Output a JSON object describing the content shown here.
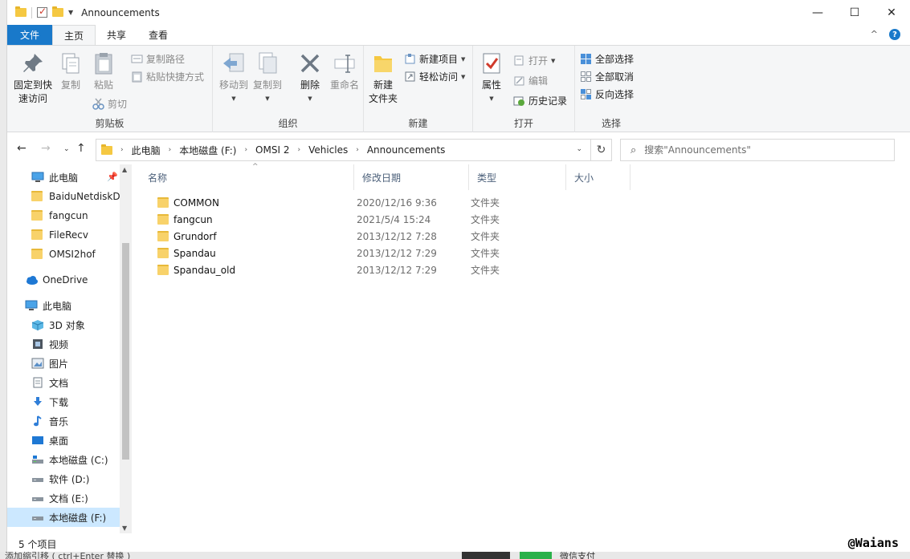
{
  "window": {
    "title": "Announcements",
    "controls": {
      "minimize": "—",
      "maximize": "☐",
      "close": "✕"
    }
  },
  "ribbon_tabs": [
    "文件",
    "主页",
    "共享",
    "查看"
  ],
  "ribbon_right": {
    "collapse": "^",
    "help": "?"
  },
  "ribbon": {
    "clipboard": {
      "label": "剪贴板",
      "pin": "固定到快速访问",
      "pin_line1": "固定到快",
      "pin_line2": "速访问",
      "copy": "复制",
      "paste": "粘贴",
      "copy_path": "复制路径",
      "paste_shortcut": "粘贴快捷方式",
      "cut": "剪切"
    },
    "organize": {
      "label": "组织",
      "move_to": "移动到",
      "copy_to": "复制到",
      "delete": "删除",
      "rename": "重命名"
    },
    "new": {
      "label": "新建",
      "new_folder_line1": "新建",
      "new_folder_line2": "文件夹",
      "new_item": "新建项目",
      "easy_access": "轻松访问"
    },
    "open": {
      "label": "打开",
      "properties": "属性",
      "open": "打开",
      "edit": "编辑",
      "history": "历史记录"
    },
    "select": {
      "label": "选择",
      "select_all": "全部选择",
      "select_none": "全部取消",
      "invert": "反向选择"
    }
  },
  "address": {
    "crumbs": [
      "此电脑",
      "本地磁盘 (F:)",
      "OMSI 2",
      "Vehicles",
      "Announcements"
    ]
  },
  "search": {
    "placeholder": "搜索\"Announcements\""
  },
  "nav_pane": {
    "quick_access": [
      {
        "label": "此电脑",
        "icon": "pc-icon"
      },
      {
        "label": "BaiduNetdiskD",
        "icon": "folder-icon"
      },
      {
        "label": "fangcun",
        "icon": "folder-icon"
      },
      {
        "label": "FileRecv",
        "icon": "folder-icon"
      },
      {
        "label": "OMSI2hof",
        "icon": "folder-icon"
      }
    ],
    "onedrive": "OneDrive",
    "this_pc": "此电脑",
    "pc_items": [
      {
        "label": "3D 对象",
        "icon": "3d-objects-icon"
      },
      {
        "label": "视频",
        "icon": "video-icon"
      },
      {
        "label": "图片",
        "icon": "pictures-icon"
      },
      {
        "label": "文档",
        "icon": "documents-icon"
      },
      {
        "label": "下载",
        "icon": "download-icon"
      },
      {
        "label": "音乐",
        "icon": "music-icon"
      },
      {
        "label": "桌面",
        "icon": "desktop-icon"
      },
      {
        "label": "本地磁盘 (C:)",
        "icon": "drive-c-icon"
      },
      {
        "label": "软件 (D:)",
        "icon": "drive-icon"
      },
      {
        "label": "文档 (E:)",
        "icon": "drive-icon"
      },
      {
        "label": "本地磁盘 (F:)",
        "icon": "drive-icon"
      }
    ]
  },
  "columns": [
    "名称",
    "修改日期",
    "类型",
    "大小"
  ],
  "files": [
    {
      "name": "COMMON",
      "date": "2020/12/16 9:36",
      "type": "文件夹"
    },
    {
      "name": "fangcun",
      "date": "2021/5/4 15:24",
      "type": "文件夹"
    },
    {
      "name": "Grundorf",
      "date": "2013/12/12 7:28",
      "type": "文件夹"
    },
    {
      "name": "Spandau",
      "date": "2013/12/12 7:29",
      "type": "文件夹"
    },
    {
      "name": "Spandau_old",
      "date": "2013/12/12 7:29",
      "type": "文件夹"
    }
  ],
  "status": {
    "count": "5 个项目"
  },
  "watermark": "@Waians",
  "background": {
    "bottom_text": "添加缩引移 ( ctrl+Enter 替换 )",
    "wechat_pay": "微信支付"
  }
}
